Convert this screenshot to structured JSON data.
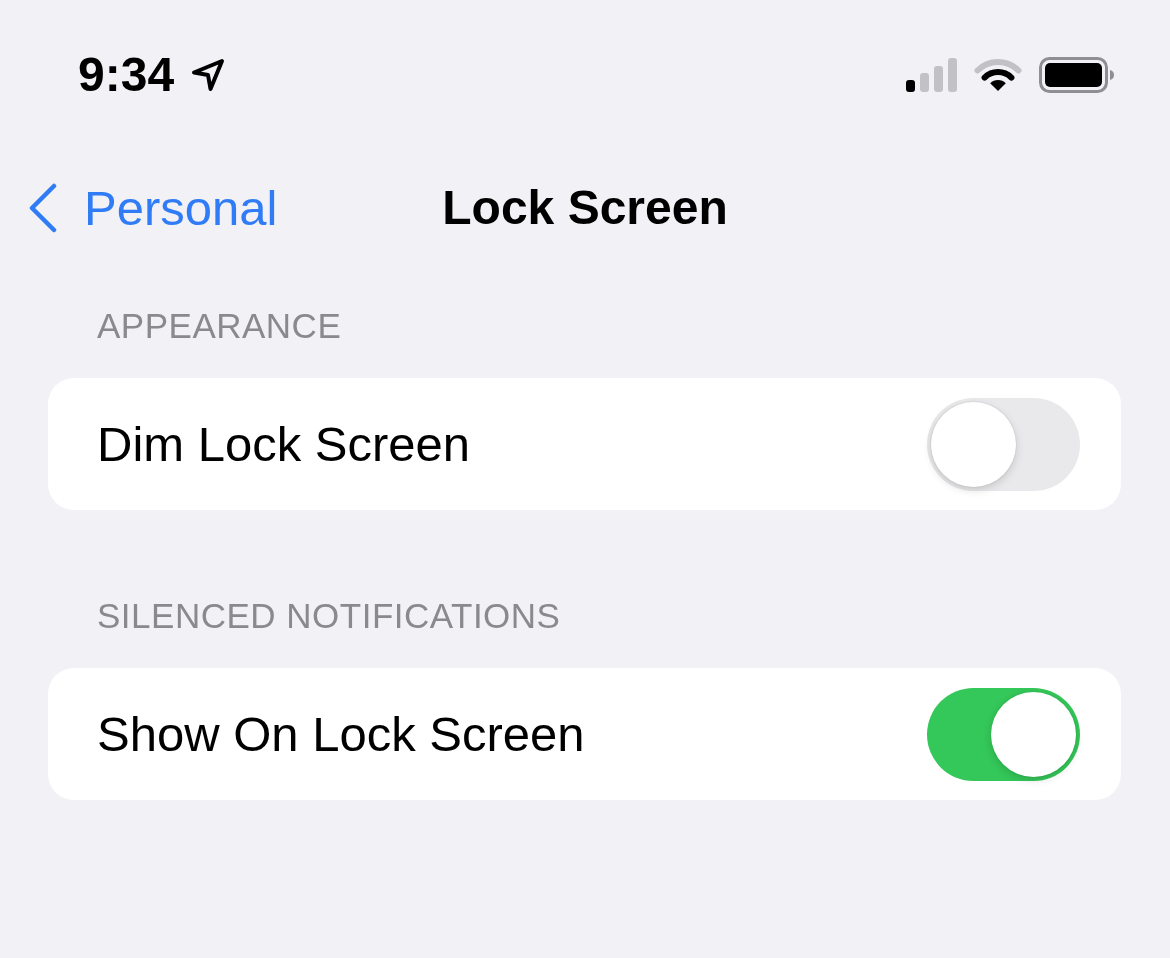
{
  "status_bar": {
    "time": "9:34"
  },
  "nav": {
    "back_label": "Personal",
    "title": "Lock Screen"
  },
  "sections": [
    {
      "header": "APPEARANCE",
      "rows": [
        {
          "label": "Dim Lock Screen",
          "on": false
        }
      ]
    },
    {
      "header": "SILENCED NOTIFICATIONS",
      "rows": [
        {
          "label": "Show On Lock Screen",
          "on": true
        }
      ]
    }
  ]
}
